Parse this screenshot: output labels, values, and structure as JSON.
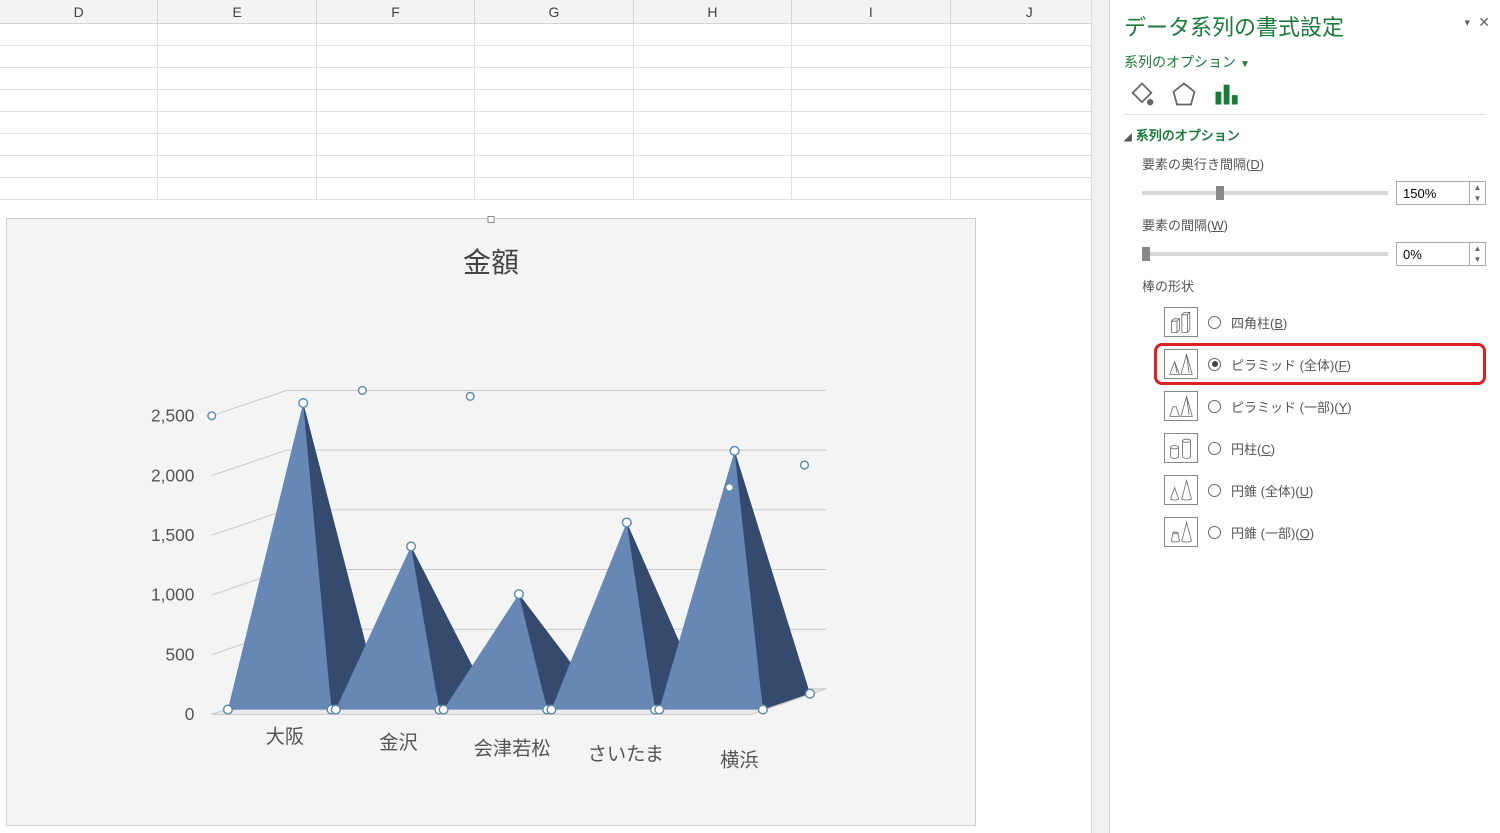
{
  "column_headers": [
    "D",
    "E",
    "F",
    "G",
    "H",
    "I",
    "J"
  ],
  "chart_data": {
    "type": "bar",
    "title": "金額",
    "ylabel": "",
    "ylim": [
      0,
      2500
    ],
    "yticks": [
      "0",
      "500",
      "1,000",
      "1,500",
      "2,000",
      "2,500"
    ],
    "categories": [
      "大阪",
      "金沢",
      "会津若松",
      "さいたま",
      "横浜"
    ],
    "values": [
      2500,
      1300,
      900,
      1500,
      2100
    ]
  },
  "panel": {
    "title": "データ系列の書式設定",
    "options_dropdown": "系列のオプション",
    "section_title": "系列のオプション",
    "gap_depth": {
      "label_pre": "要素の奥行き間隔(",
      "label_u": "D",
      "label_post": ")",
      "value": "150%"
    },
    "gap_width": {
      "label_pre": "要素の間隔(",
      "label_u": "W",
      "label_post": ")",
      "value": "0%"
    },
    "shape_label": "棒の形状",
    "shapes": {
      "box": {
        "pre": "四角柱(",
        "u": "B",
        "post": ")"
      },
      "full_pyramid": {
        "pre": "ピラミッド (全体)(",
        "u": "F",
        "post": ")"
      },
      "partial_pyramid": {
        "pre": "ピラミッド (一部)(",
        "u": "Y",
        "post": ")"
      },
      "cylinder": {
        "pre": "円柱(",
        "u": "C",
        "post": ")"
      },
      "full_cone": {
        "pre": "円錐 (全体)(",
        "u": "U",
        "post": ")"
      },
      "partial_cone": {
        "pre": "円錐 (一部)(",
        "u": "O",
        "post": ")"
      }
    }
  }
}
